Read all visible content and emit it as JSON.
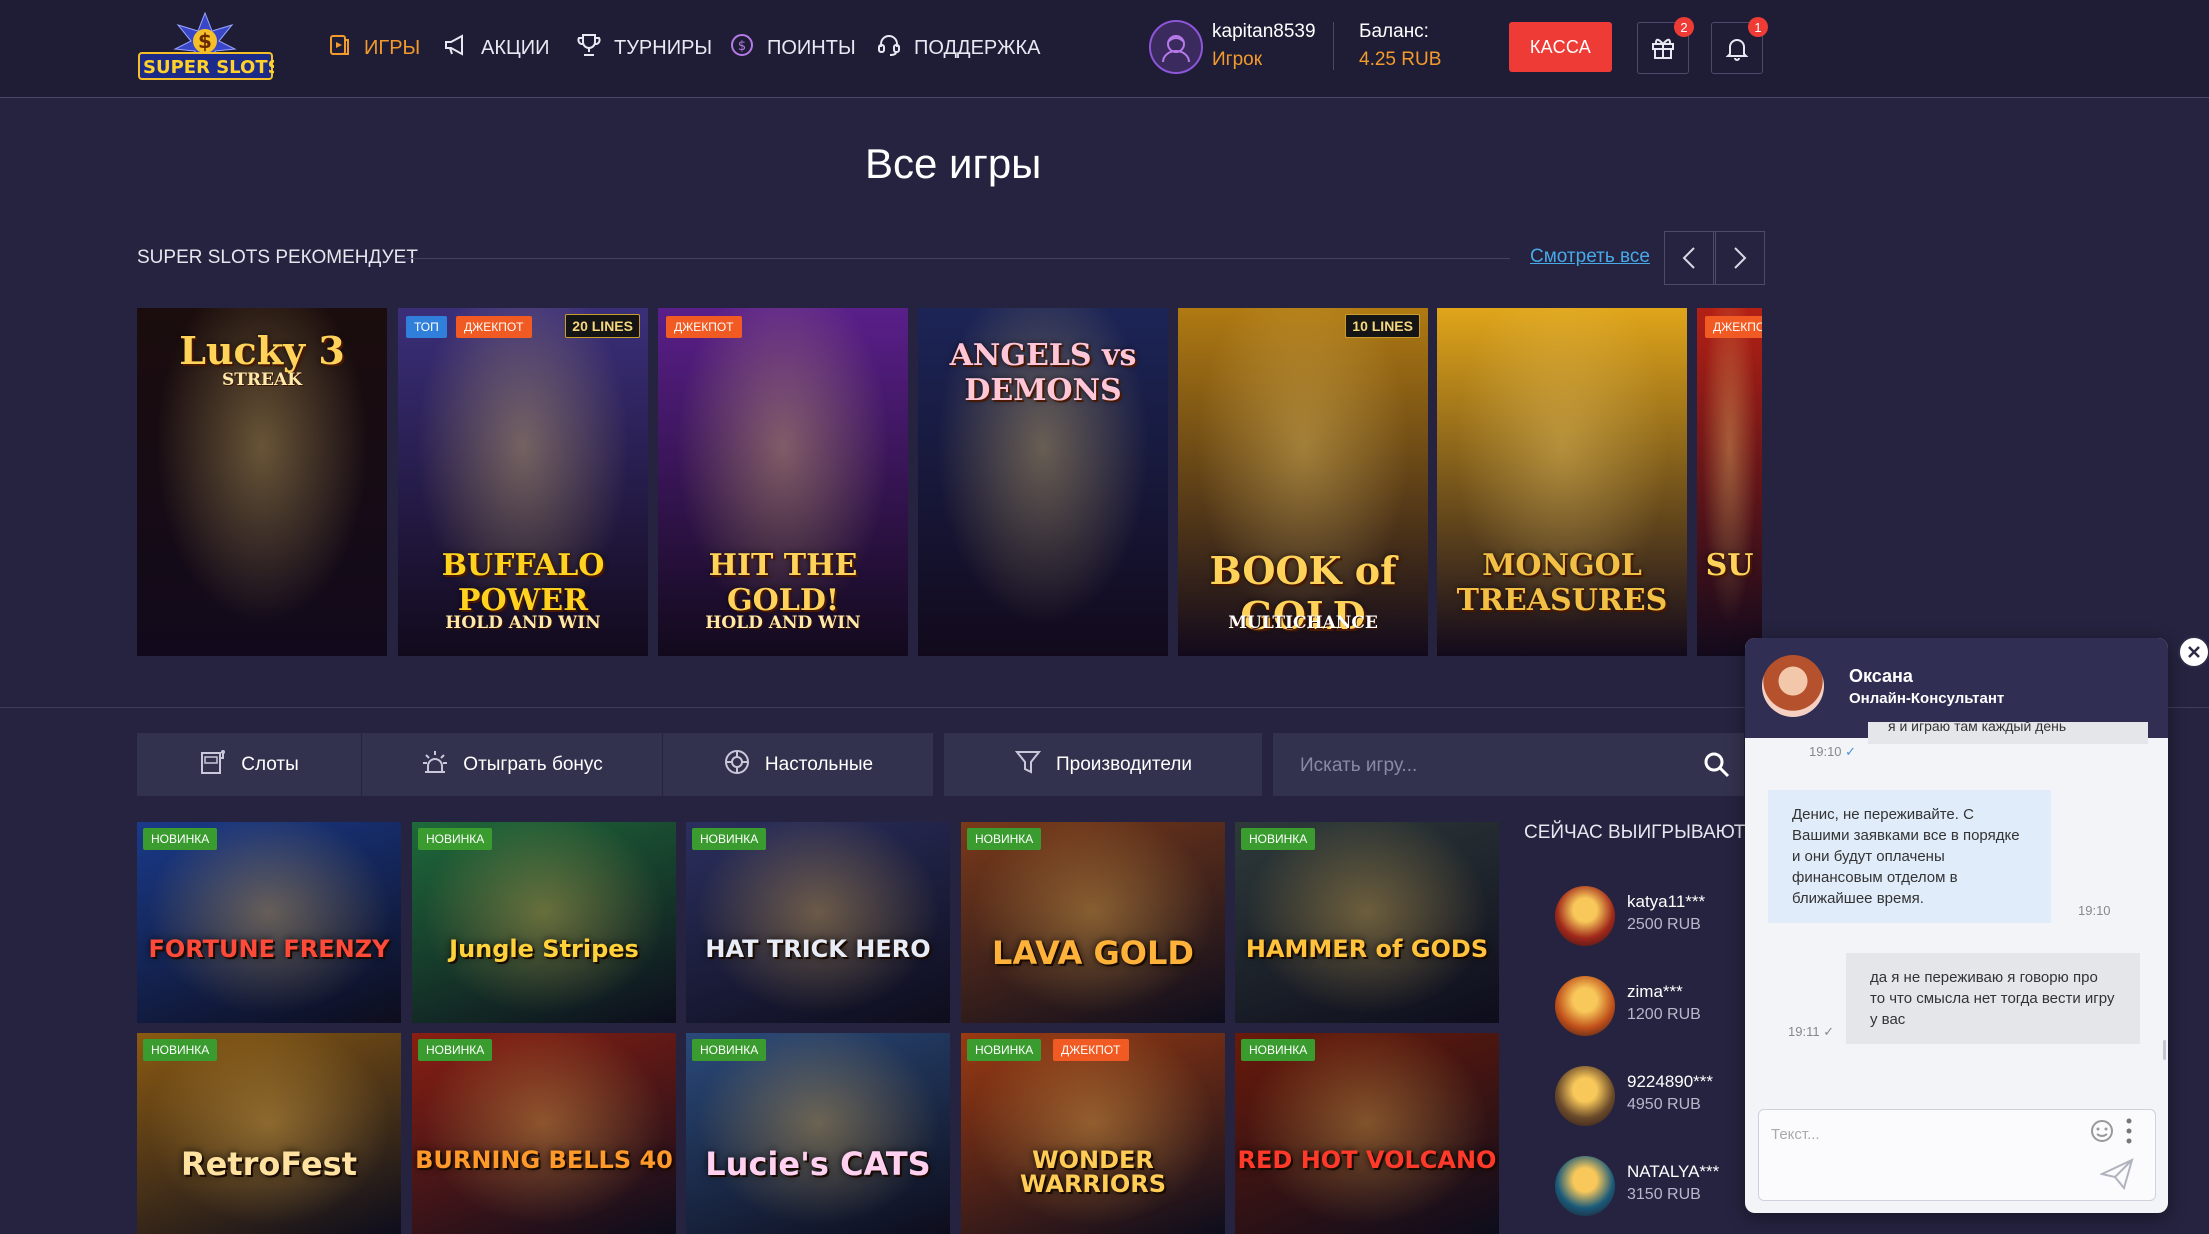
{
  "header": {
    "logo_line1": "SUPER",
    "logo_line2": "SLOTS",
    "logo_symbol": "$",
    "nav": [
      {
        "label": "ИГРЫ",
        "icon": "game-card-icon",
        "active": true
      },
      {
        "label": "АКЦИИ",
        "icon": "megaphone-icon",
        "active": false
      },
      {
        "label": "ТУРНИРЫ",
        "icon": "trophy-icon",
        "active": false
      },
      {
        "label": "ПОИНТЫ",
        "icon": "coin-icon",
        "active": false
      },
      {
        "label": "ПОДДЕРЖКА",
        "icon": "headset-icon",
        "active": false
      }
    ],
    "user": {
      "name": "kapitan8539",
      "role": "Игрок"
    },
    "balance": {
      "label": "Баланс:",
      "value": "4.25 RUB"
    },
    "cash_button": "КАССА",
    "gift_badge": "2",
    "notification_badge": "1"
  },
  "page_title": "Все игры",
  "recommend": {
    "title": "SUPER SLOTS РЕКОМЕНДУЕТ",
    "see_all": "Смотреть все",
    "games": [
      {
        "title": "Lucky 3",
        "subtitle": "STREAK",
        "tags": [],
        "lines": "",
        "bg": "#1b0d0d"
      },
      {
        "title": "BUFFALO POWER",
        "subtitle": "HOLD AND WIN",
        "tags": [
          "ТОП",
          "ДЖЕКПОТ"
        ],
        "lines": "20 LINES",
        "bg": "#3b2f7a"
      },
      {
        "title": "HIT THE GOLD!",
        "subtitle": "HOLD AND WIN",
        "tags": [
          "ДЖЕКПОТ"
        ],
        "lines": "",
        "bg": "#5a1f8a"
      },
      {
        "title": "ANGELS vs DEMONS",
        "subtitle": "",
        "tags": [],
        "lines": "",
        "bg": "#1c2557"
      },
      {
        "title": "BOOK of GOLD",
        "subtitle": "MULTICHANCE",
        "tags": [],
        "lines": "10 LINES",
        "bg": "#b07a12"
      },
      {
        "title": "MONGOL TREASURES",
        "subtitle": "",
        "tags": [],
        "lines": "",
        "bg": "#e0a51a"
      },
      {
        "title": "SU",
        "subtitle": "",
        "tags": [
          "ДЖЕКПОТ"
        ],
        "lines": "",
        "bg": "#b42015"
      }
    ]
  },
  "filters": {
    "slots": "Слоты",
    "bonus": "Отыграть бонус",
    "table": "Настольные",
    "providers": "Производители",
    "search_placeholder": "Искать игру..."
  },
  "games": [
    {
      "title": "FORTUNE FRENZY",
      "tags": [
        "НОВИНКА"
      ],
      "bg": "#1a3a8a"
    },
    {
      "title": "Jungle Stripes",
      "tags": [
        "НОВИНКА"
      ],
      "bg": "#1f6a3a"
    },
    {
      "title": "HAT TRICK HERO",
      "tags": [
        "НОВИНКА"
      ],
      "bg": "#2b2f5e"
    },
    {
      "title": "LAVA GOLD",
      "tags": [
        "НОВИНКА"
      ],
      "bg": "#7a3a1a"
    },
    {
      "title": "HAMMER of GODS",
      "tags": [
        "НОВИНКА"
      ],
      "bg": "#2e3a3a"
    },
    {
      "title": "RetroFest",
      "tags": [
        "НОВИНКА"
      ],
      "bg": "#8a5a12"
    },
    {
      "title": "BURNING BELLS 40",
      "tags": [
        "НОВИНКА"
      ],
      "bg": "#8a1f12"
    },
    {
      "title": "Lucie's CATS",
      "tags": [
        "НОВИНКА"
      ],
      "bg": "#2a4a7a"
    },
    {
      "title": "WONDER WARRIORS",
      "tags": [
        "НОВИНКА",
        "ДЖЕКПОТ"
      ],
      "bg": "#9a3a12"
    },
    {
      "title": "RED HOT VOLCANO",
      "tags": [
        "НОВИНКА"
      ],
      "bg": "#6a1a0a"
    }
  ],
  "winners": {
    "title": "СЕЙЧАС ВЫИГРЫВАЮТ",
    "items": [
      {
        "name": "katya11***",
        "amount": "2500 RUB",
        "color": "#a0281a"
      },
      {
        "name": "zima***",
        "amount": "1200 RUB",
        "color": "#c0501a"
      },
      {
        "name": "9224890***",
        "amount": "4950 RUB",
        "color": "#6a4a2a"
      },
      {
        "name": "NATALYA***",
        "amount": "3150 RUB",
        "color": "#1a5a7a"
      }
    ]
  },
  "chat": {
    "agent_name": "Оксана",
    "agent_role": "Онлайн-Консультант",
    "messages": [
      {
        "text": "я и играю там каждый день",
        "time": "19:10",
        "from": "user"
      },
      {
        "text": "Денис, не переживайте. С Вашими заявками все в порядке и они будут оплачены финансовым отделом в ближайшее время.",
        "time": "19:10",
        "from": "agent"
      },
      {
        "text": "да я не переживаю я говорю про то что смысла нет тогда вести игру у вас",
        "time": "19:11",
        "from": "user"
      }
    ],
    "input_placeholder": "Текст..."
  }
}
